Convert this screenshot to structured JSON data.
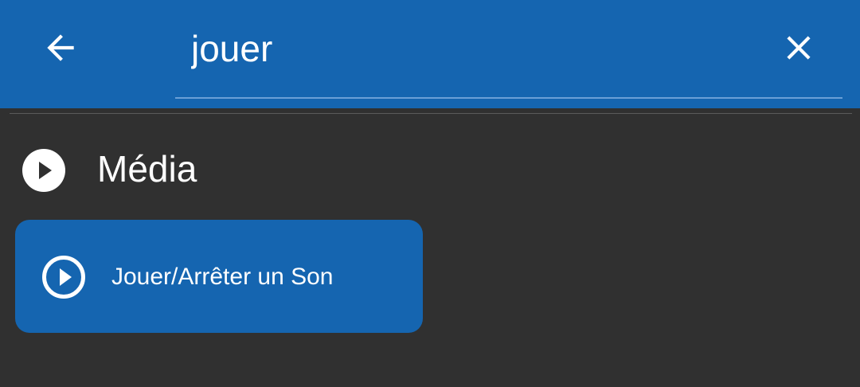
{
  "colors": {
    "app_bar": "#1565b0",
    "background": "#303030",
    "card": "#1565b0",
    "text": "#ffffff"
  },
  "header": {
    "back_icon": "arrow-left-icon",
    "search_value": "jouer",
    "clear_icon": "close-icon"
  },
  "category": {
    "icon": "play-circle-filled-icon",
    "label": "Média"
  },
  "results": [
    {
      "icon": "play-circle-outline-icon",
      "label": "Jouer/Arrêter un Son"
    }
  ]
}
